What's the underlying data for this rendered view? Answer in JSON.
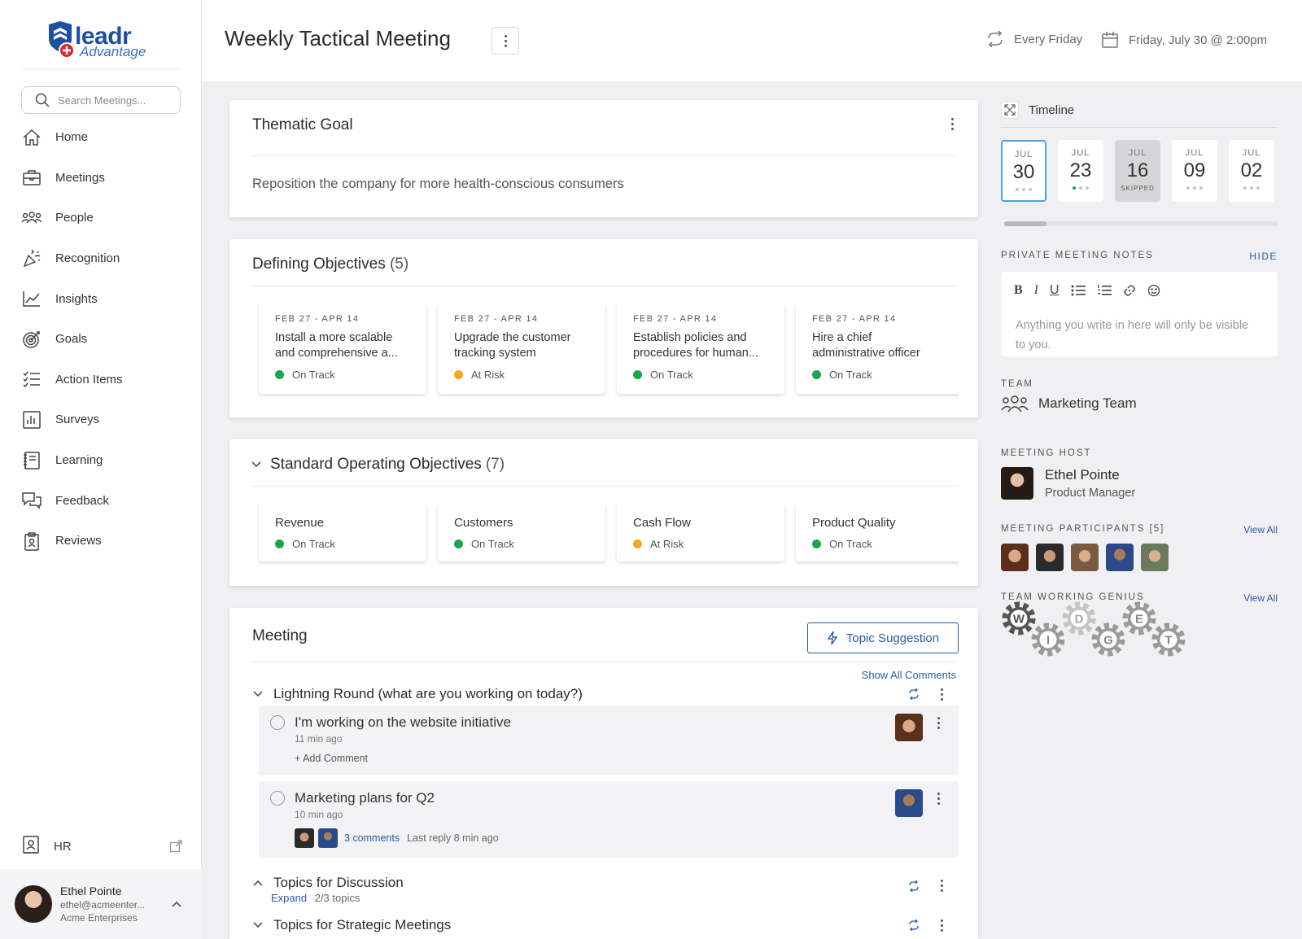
{
  "sidebar": {
    "logo": {
      "word": "leadr",
      "sub": "Advantage"
    },
    "search_placeholder": "Search Meetings...",
    "items": [
      {
        "label": "Home",
        "icon": "home-icon"
      },
      {
        "label": "Meetings",
        "icon": "briefcase-icon"
      },
      {
        "label": "People",
        "icon": "people-icon"
      },
      {
        "label": "Recognition",
        "icon": "party-icon"
      },
      {
        "label": "Insights",
        "icon": "chart-line-icon"
      },
      {
        "label": "Goals",
        "icon": "target-icon"
      },
      {
        "label": "Action Items",
        "icon": "checklist-icon"
      },
      {
        "label": "Surveys",
        "icon": "bar-chart-icon"
      },
      {
        "label": "Learning",
        "icon": "book-icon"
      },
      {
        "label": "Feedback",
        "icon": "chat-icon"
      },
      {
        "label": "Reviews",
        "icon": "clipboard-icon"
      }
    ],
    "hr_label": "HR",
    "user": {
      "name": "Ethel Pointe",
      "email": "ethel@acmeenter...",
      "company": "Acme Enterprises"
    }
  },
  "header": {
    "title": "Weekly Tactical Meeting",
    "recurrence": "Every Friday",
    "datetime": "Friday, July 30 @ 2:00pm"
  },
  "thematic": {
    "title": "Thematic Goal",
    "text": "Reposition the company for more health-conscious consumers"
  },
  "defining": {
    "title": "Defining Objectives",
    "count": "(5)",
    "items": [
      {
        "date": "FEB 27 - APR 14",
        "name": "Install a more scalable and comprehensive a...",
        "status": "On Track",
        "color": "#1aa64a"
      },
      {
        "date": "FEB 27 - APR 14",
        "name": "Upgrade the customer tracking system",
        "status": "At Risk",
        "color": "#f5a623"
      },
      {
        "date": "FEB 27 - APR 14",
        "name": "Establish policies and procedures for human...",
        "status": "On Track",
        "color": "#1aa64a"
      },
      {
        "date": "FEB 27 - APR 14",
        "name": "Hire a chief administrative officer",
        "status": "On Track",
        "color": "#1aa64a"
      }
    ]
  },
  "sop": {
    "title": "Standard Operating Objectives",
    "count": "(7)",
    "items": [
      {
        "name": "Revenue",
        "status": "On Track",
        "color": "#1aa64a"
      },
      {
        "name": "Customers",
        "status": "On Track",
        "color": "#1aa64a"
      },
      {
        "name": "Cash Flow",
        "status": "At Risk",
        "color": "#f5a623"
      },
      {
        "name": "Product Quality",
        "status": "On Track",
        "color": "#1aa64a"
      }
    ]
  },
  "meeting": {
    "title": "Meeting",
    "topic_btn": "Topic Suggestion",
    "show_all": "Show All Comments",
    "section1": "Lightning Round (what are you working on today?)",
    "item1": {
      "title": "I'm working on the website initiative",
      "ago": "11 min ago",
      "add": "+ Add Comment"
    },
    "item2": {
      "title": "Marketing plans for Q2",
      "ago": "10 min ago",
      "comments": "3 comments",
      "reply": "Last reply 8 min ago"
    },
    "section2": "Topics for Discussion",
    "section2_expand": "Expand",
    "section2_count": "2/3 topics",
    "section3": "Topics for Strategic Meetings"
  },
  "right": {
    "timeline": "Timeline",
    "days": [
      {
        "m": "JUL",
        "d": "30"
      },
      {
        "m": "JUL",
        "d": "23"
      },
      {
        "m": "JUL",
        "d": "16",
        "skip": "SKIPPED"
      },
      {
        "m": "JUL",
        "d": "09"
      },
      {
        "m": "JUL",
        "d": "02"
      }
    ],
    "notes_label": "PRIVATE MEETING NOTES",
    "hide": "HIDE",
    "notes_placeholder": "Anything you write in here will only be visible to you.",
    "team_label": "TEAM",
    "team": "Marketing Team",
    "host_label": "MEETING HOST",
    "host_name": "Ethel Pointe",
    "host_role": "Product Manager",
    "participants_label": "MEETING PARTICIPANTS [5]",
    "view_all": "View All",
    "genius_label": "TEAM WORKING GENIUS",
    "genius_letters": [
      "W",
      "I",
      "D",
      "G",
      "E",
      "T"
    ]
  }
}
